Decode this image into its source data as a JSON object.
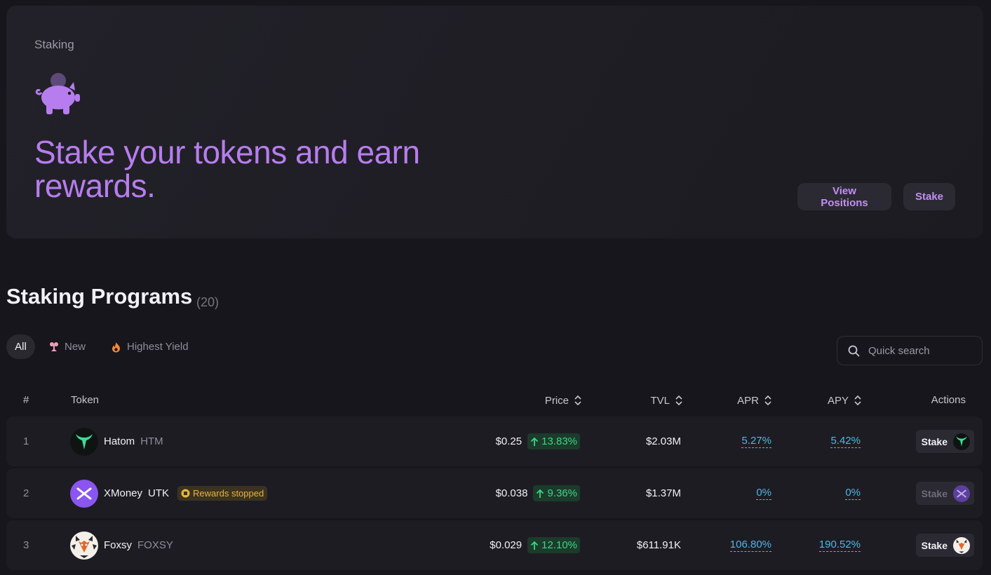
{
  "hero": {
    "breadcrumb": "Staking",
    "title": "Stake your tokens and earn rewards.",
    "view_positions_label": "View Positions",
    "stake_label": "Stake",
    "accent_color": "#b77dee"
  },
  "programs": {
    "title": "Staking Programs",
    "count": "(20)",
    "filters": [
      {
        "label": "All",
        "icon": "all"
      },
      {
        "label": "New",
        "icon": "sprout-icon"
      },
      {
        "label": "Highest Yield",
        "icon": "fire-icon"
      }
    ],
    "search": {
      "placeholder": "Quick search"
    },
    "columns": {
      "rank": "#",
      "token": "Token",
      "price": "Price",
      "tvl": "TVL",
      "apr": "APR",
      "apy": "APY",
      "actions": "Actions"
    },
    "rows": [
      {
        "rank": "1",
        "name": "Hatom",
        "symbol": "HTM",
        "badge": "",
        "price": "$0.25",
        "change": "13.83%",
        "tvl": "$2.03M",
        "apr": "5.27%",
        "apy": "5.42%",
        "action": "Stake",
        "action_enabled": true,
        "logo": "hatom-logo-icon"
      },
      {
        "rank": "2",
        "name": "XMoney",
        "symbol": "UTK",
        "badge": "Rewards stopped",
        "price": "$0.038",
        "change": "9.36%",
        "tvl": "$1.37M",
        "apr": "0%",
        "apy": "0%",
        "action": "Stake",
        "action_enabled": false,
        "logo": "xmoney-logo-icon"
      },
      {
        "rank": "3",
        "name": "Foxsy",
        "symbol": "FOXSY",
        "badge": "",
        "price": "$0.029",
        "change": "12.10%",
        "tvl": "$611.91K",
        "apr": "106.80%",
        "apy": "190.52%",
        "action": "Stake",
        "action_enabled": true,
        "logo": "foxsy-logo-icon"
      }
    ]
  }
}
